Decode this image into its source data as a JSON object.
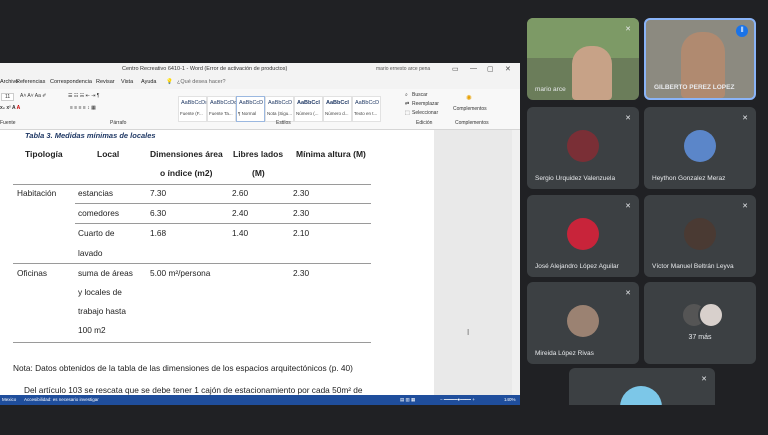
{
  "word": {
    "title": "Centro Recreativo 6410-1  -  Word (Error de activación de productos)",
    "user": "mario ernesto arce pena",
    "menu": [
      "Archivo",
      "Referencias",
      "Correspondencia",
      "Revisar",
      "Vista",
      "Ayuda",
      "¿Qué desea hacer?"
    ],
    "styles": [
      {
        "preview": "AaBbCcDı",
        "name": "Fuente (F..."
      },
      {
        "preview": "AaBbCcDd",
        "name": "Fuente Ta..."
      },
      {
        "preview": "AaBbCcD",
        "name": "¶ Normal"
      },
      {
        "preview": "AaBbCcD",
        "name": "Nota (Sigu..."
      },
      {
        "preview": "AaBbCcI",
        "name": "Número (..."
      },
      {
        "preview": "AaBbCcI",
        "name": "Número d..."
      },
      {
        "preview": "AaBbCcD",
        "name": "Texto en t..."
      }
    ],
    "editing": [
      "Buscar",
      "Reemplazar",
      "Seleccionar"
    ],
    "groups": {
      "fuente": "Fuente",
      "parrafo": "Párrafo",
      "estilos": "Estilos",
      "edicion": "Edición",
      "complementos": "Complementos"
    },
    "complementos_btn": "Complementos",
    "font_size": "11",
    "statusbar": {
      "left": "Mexico",
      "access": "Accesibilidad: es necesario investigar",
      "zoom": "140%"
    }
  },
  "document": {
    "caption": "Tabla 3. Medidas mínimas de locales",
    "headers": {
      "tipologia": "Tipología",
      "local": "Local",
      "dimensiones_1": "Dimensiones área",
      "dimensiones_2": "o índice (m2)",
      "libres_1": "Libres lados",
      "libres_2": "(M)",
      "altura": "Mínima altura (M)"
    },
    "rows": [
      {
        "tipologia": "Habitación",
        "local": "estancias",
        "dim": "7.30",
        "libres": "2.60",
        "altura": "2.30"
      },
      {
        "tipologia": "",
        "local": "comedores",
        "dim": "6.30",
        "libres": "2.40",
        "altura": "2.30"
      },
      {
        "tipologia": "",
        "local": "Cuarto de",
        "local2": "lavado",
        "dim": "1.68",
        "libres": "1.40",
        "altura": "2.10"
      },
      {
        "tipologia": "Oficinas",
        "local": "suma de áreas",
        "local2": "y locales de",
        "local3": "trabajo hasta",
        "local4": "100 m2",
        "dim": "5.00 m²/persona",
        "libres": "",
        "altura": "2.30"
      }
    ],
    "note": "Nota: Datos obtenidos de la tabla de las dimensiones de los espacios arquitectónicos (p. 40)",
    "paragraph": "Del artículo 103 se rescata que se debe tener 1 cajón de estacionamiento por cada 50m² de"
  },
  "participants": [
    {
      "name": "mario arce"
    },
    {
      "name": "GILBERTO PEREZ LOPEZ"
    },
    {
      "name": "Sergio Urquidez Valenzuela"
    },
    {
      "name": "Heython Gonzalez Meraz"
    },
    {
      "name": "José Alejandro López Aguilar"
    },
    {
      "name": "Víctor Manuel Beltrán Leyva"
    },
    {
      "name": "Mireida López Rivas"
    },
    {
      "name": "37 más"
    }
  ],
  "colors": {
    "tile": "#3c4043",
    "bg": "#202124",
    "word_blue": "#1f4e9c",
    "active_border": "#8ab4f8"
  },
  "icons": {
    "mic_off": "mic-off-icon",
    "audio": "audio-active-icon"
  }
}
